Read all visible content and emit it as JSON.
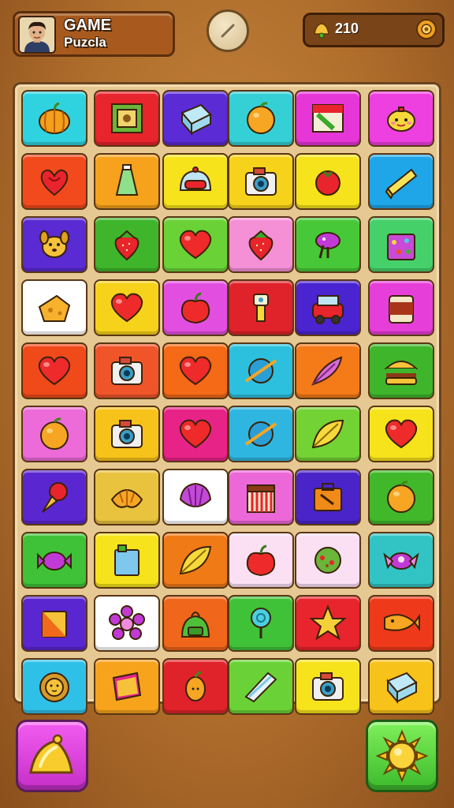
{
  "header": {
    "title_line1": "GAME",
    "title_line2": "Puzcla",
    "score": "210"
  },
  "board": {
    "tiles": [
      {
        "color": "#2fd3e0",
        "icon": "pumpkin-icon"
      },
      {
        "color": "#e8242c",
        "icon": "framed-picture-icon"
      },
      {
        "color": "#5b2bd6",
        "icon": "ice-cube-icon"
      },
      {
        "color": "#35d0d6",
        "icon": "orange-icon"
      },
      {
        "color": "#e636d8",
        "icon": "flag-icon"
      },
      {
        "color": "#ee3fe0",
        "icon": "teapot-icon"
      },
      {
        "color": "#f24a1d",
        "icon": "red-ribbon-icon"
      },
      {
        "color": "#f6a21c",
        "icon": "bottle-icon"
      },
      {
        "color": "#f7e31b",
        "icon": "helmet-icon"
      },
      {
        "color": "#f7d21a",
        "icon": "camera-icon"
      },
      {
        "color": "#f7e31b",
        "icon": "tomato-icon"
      },
      {
        "color": "#1fa6e8",
        "icon": "cheese-icon"
      },
      {
        "color": "#5a2ad2",
        "icon": "dog-face-icon"
      },
      {
        "color": "#3fb52b",
        "icon": "strawberry-icon"
      },
      {
        "color": "#6ad236",
        "icon": "heart-icon"
      },
      {
        "color": "#f58fd6",
        "icon": "strawberry-icon"
      },
      {
        "color": "#47c838",
        "icon": "mushroom-icon"
      },
      {
        "color": "#45d06a",
        "icon": "gift-box-icon"
      },
      {
        "color": "#ffffff",
        "icon": "cheese-wedge-icon"
      },
      {
        "color": "#f7d21a",
        "icon": "heart-icon"
      },
      {
        "color": "#e24fe0",
        "icon": "apple-icon"
      },
      {
        "color": "#e0232a",
        "icon": "robot-icon"
      },
      {
        "color": "#4a24d0",
        "icon": "car-icon"
      },
      {
        "color": "#e63ed8",
        "icon": "jar-icon"
      },
      {
        "color": "#f04a1a",
        "icon": "heart-icon"
      },
      {
        "color": "#f0552a",
        "icon": "camera-icon"
      },
      {
        "color": "#f46a16",
        "icon": "heart-icon"
      },
      {
        "color": "#2cc0de",
        "icon": "planet-icon"
      },
      {
        "color": "#f57a18",
        "icon": "feather-icon"
      },
      {
        "color": "#3fb52b",
        "icon": "burger-icon"
      },
      {
        "color": "#ec6bd8",
        "icon": "orange-icon"
      },
      {
        "color": "#f7c21a",
        "icon": "camera-icon"
      },
      {
        "color": "#e82388",
        "icon": "heart-icon"
      },
      {
        "color": "#2fb6e0",
        "icon": "planet-icon"
      },
      {
        "color": "#73d234",
        "icon": "leaf-icon"
      },
      {
        "color": "#f7e31b",
        "icon": "heart-icon"
      },
      {
        "color": "#5a26d0",
        "icon": "ice-cream-icon"
      },
      {
        "color": "#e9c23e",
        "icon": "croissant-icon"
      },
      {
        "color": "#ffffff",
        "icon": "seashell-icon"
      },
      {
        "color": "#ec68d8",
        "icon": "basket-icon"
      },
      {
        "color": "#4a24c8",
        "icon": "toolbox-icon"
      },
      {
        "color": "#40b82a",
        "icon": "orange-icon"
      },
      {
        "color": "#3fc238",
        "icon": "candy-icon"
      },
      {
        "color": "#f7e31b",
        "icon": "juice-box-icon"
      },
      {
        "color": "#f07a16",
        "icon": "leaf-icon"
      },
      {
        "color": "#fbe0f4",
        "icon": "apple-icon"
      },
      {
        "color": "#fbe0f4",
        "icon": "melon-icon"
      },
      {
        "color": "#32c4c4",
        "icon": "spaceship-icon"
      },
      {
        "color": "#5a26d0",
        "icon": "box-icon"
      },
      {
        "color": "#ffffff",
        "icon": "flower-icon"
      },
      {
        "color": "#f0661a",
        "icon": "backpack-icon"
      },
      {
        "color": "#3fc238",
        "icon": "lollipop-icon"
      },
      {
        "color": "#e8242c",
        "icon": "star-icon"
      },
      {
        "color": "#ee3a1a",
        "icon": "fish-icon"
      },
      {
        "color": "#2fc0e8",
        "icon": "lion-icon"
      },
      {
        "color": "#f7a31c",
        "icon": "book-icon"
      },
      {
        "color": "#e0232a",
        "icon": "mango-icon"
      },
      {
        "color": "#6ad236",
        "icon": "crystal-icon"
      },
      {
        "color": "#f7e31b",
        "icon": "camera-icon"
      },
      {
        "color": "#f7c21a",
        "icon": "ice-cube-icon"
      }
    ]
  },
  "footer": {
    "left_icon": "bell-icon",
    "right_icon": "sun-icon"
  }
}
